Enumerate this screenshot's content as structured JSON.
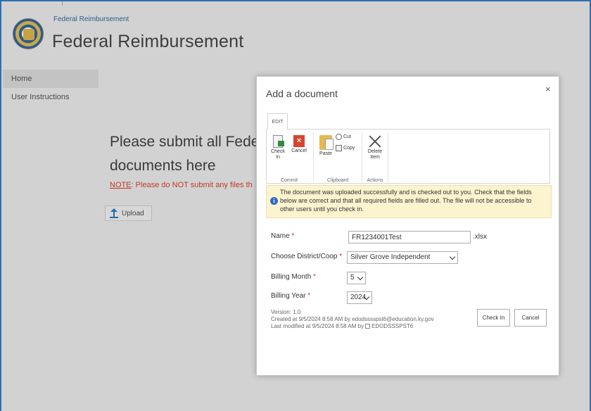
{
  "site": {
    "subtitle": "Federal Reimbursement",
    "title": "Federal Reimbursement"
  },
  "nav": {
    "items": [
      {
        "label": "Home",
        "active": true
      },
      {
        "label": "User Instructions",
        "active": false
      }
    ]
  },
  "main": {
    "heading_line1": "Please submit all Fede",
    "heading_line2": "documents here",
    "note_label": "NOTE",
    "note_text": ": Please do NOT submit any files th",
    "upload_label": "Upload"
  },
  "dialog": {
    "title": "Add a document",
    "close_glyph": "×",
    "ribbon": {
      "tab": "EDIT",
      "groups": {
        "commit": "Commit",
        "clipboard": "Clipboard",
        "actions": "Actions"
      },
      "buttons": {
        "check_in_1": "Check",
        "check_in_2": "In",
        "cancel": "Cancel",
        "paste": "Paste",
        "cut": "Cut",
        "copy": "Copy",
        "delete_1": "Delete",
        "delete_2": "Item"
      }
    },
    "info_message": "The document was uploaded successfully and is checked out to you. Check that the fields below are correct and that all required fields are filled out. The file will not be accessible to other users until you check in.",
    "form": {
      "name_label": "Name",
      "name_value": "FR1234001Test",
      "name_ext": ".xlsx",
      "district_label": "Choose District/Coop",
      "district_value": "Silver Grove Independent",
      "month_label": "Billing Month",
      "month_value": "5",
      "year_label": "Billing Year",
      "year_value": "2024",
      "required_mark": "*"
    },
    "meta": {
      "version": "Version: 1.0",
      "created": "Created at 9/5/2024 8:58 AM  by edodsssspst6@education.ky.gov",
      "modified_prefix": "Last modified at 9/5/2024 8:58 AM  by",
      "modified_user": "EDODSSSPST6"
    },
    "buttons": {
      "check_in": "Check In",
      "cancel": "Cancel"
    }
  },
  "colors": {
    "accent_blue": "#2f6fb1",
    "required_red": "#c0392b",
    "info_bg": "#fcf3cf"
  }
}
